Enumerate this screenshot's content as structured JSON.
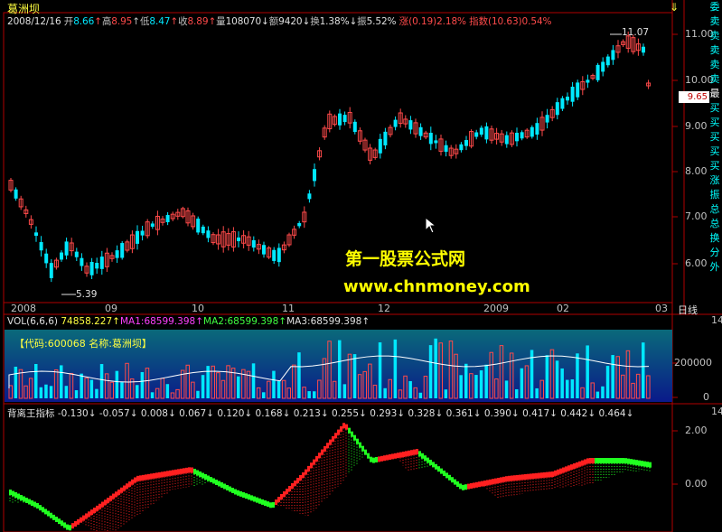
{
  "stock": {
    "title": "葛洲坝"
  },
  "quote": {
    "date": "2008/12/16",
    "open_label": "开",
    "open": "8.66",
    "high_label": "高",
    "high": "8.95",
    "low_label": "低",
    "low": "8.47",
    "close_label": "收",
    "close": "8.89",
    "vol_label": "量",
    "vol": "108070",
    "amt_label": "额",
    "amt": "9420",
    "turn_label": "换",
    "turn": "1.38%",
    "amp_label": "振",
    "amp": "5.52%",
    "chg_label": "涨",
    "chg": "(0.19)",
    "chg_pct": "2.18%",
    "idx_label": "指数",
    "idx": "(10.63)",
    "idx_pct": "0.54%"
  },
  "price_axis": [
    "11.00",
    "10.00",
    "9.00",
    "8.00",
    "7.00",
    "6.00"
  ],
  "price_tag": "9.65",
  "max_label": "11.07",
  "min_label": "5.39",
  "date_axis": [
    "2008",
    "09",
    "10",
    "11",
    "12",
    "2009",
    "02",
    "03"
  ],
  "period_label": "日线",
  "right_panel": [
    "委",
    "卖",
    "卖",
    "卖",
    "卖",
    "卖",
    "最",
    "买",
    "买",
    "买",
    "买",
    "买",
    "涨",
    "振",
    "总",
    "总",
    "换",
    "分",
    "外"
  ],
  "watermark": {
    "line1": "第一股票公式网",
    "line2": "www.chnmoney.com"
  },
  "volume": {
    "header": "VOL(6,6,6)",
    "vol": "74858.227",
    "ma1_label": "MA1:",
    "ma1": "68599.398",
    "ma2_label": "MA2:",
    "ma2": "68599.398",
    "ma3_label": "MA3:",
    "ma3": "68599.398",
    "code_text": "【代码:600068 名称:葛洲坝】",
    "axis": [
      "200000",
      "0"
    ],
    "axis_top": "14"
  },
  "indicator": {
    "name": "背离王指标",
    "values": [
      "-0.130",
      "-0.057",
      "0.008",
      "0.067",
      "0.120",
      "0.168",
      "0.213",
      "0.255",
      "0.293",
      "0.328",
      "0.361",
      "0.390",
      "0.417",
      "0.442",
      "0.464"
    ],
    "axis": [
      "2.00",
      "0.00"
    ],
    "axis_top": "14"
  },
  "colors": {
    "up": "#ff4a4a",
    "down": "#00e8ff",
    "ind_up": "#ff2020",
    "ind_down": "#20ff20",
    "grid": "#b00000"
  }
}
